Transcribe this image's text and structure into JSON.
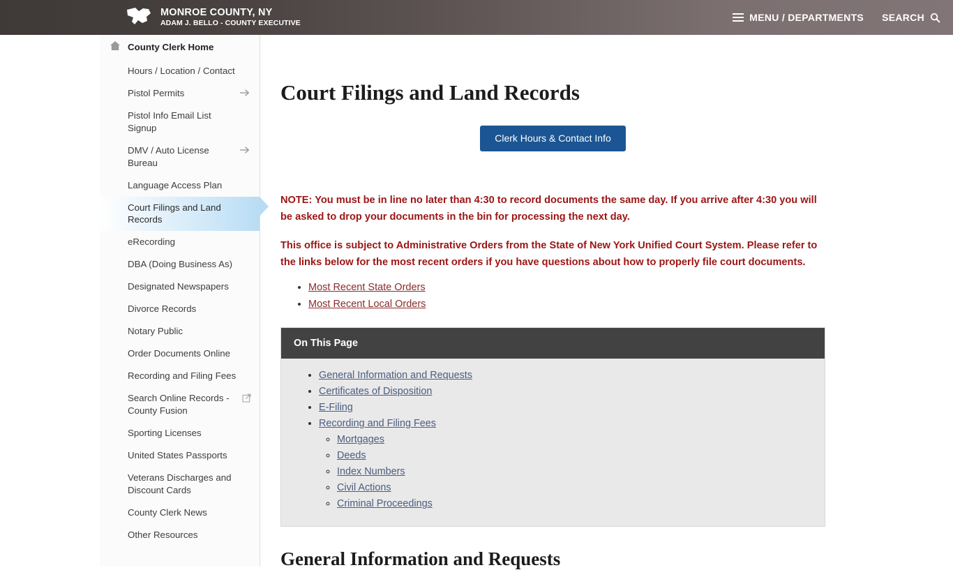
{
  "header": {
    "logo_icon": "monroe-county-map-logo",
    "brand_title": "MONROE COUNTY, NY",
    "brand_subtitle": "ADAM J. BELLO - COUNTY EXECUTIVE",
    "menu_label": "MENU / DEPARTMENTS",
    "menu_icon": "hamburger-icon",
    "search_label": "SEARCH",
    "search_icon": "search-icon",
    "gradient_left": "#3f3938",
    "gradient_right": "#827577"
  },
  "sidebar": {
    "home": {
      "label": "County Clerk Home",
      "icon": "home-icon"
    },
    "items": [
      {
        "label": "Hours / Location / Contact",
        "icon": "",
        "active": false
      },
      {
        "label": "Pistol Permits",
        "icon": "arrow-right-icon",
        "active": false
      },
      {
        "label": "Pistol Info Email List Signup",
        "icon": "",
        "active": false
      },
      {
        "label": "DMV / Auto License Bureau",
        "icon": "arrow-right-icon",
        "active": false
      },
      {
        "label": "Language Access Plan",
        "icon": "",
        "active": false
      },
      {
        "label": "Court Filings and Land Records",
        "icon": "",
        "active": true
      },
      {
        "label": "eRecording",
        "icon": "",
        "active": false
      },
      {
        "label": "DBA (Doing Business As)",
        "icon": "",
        "active": false
      },
      {
        "label": "Designated Newspapers",
        "icon": "",
        "active": false
      },
      {
        "label": "Divorce Records",
        "icon": "",
        "active": false
      },
      {
        "label": "Notary Public",
        "icon": "",
        "active": false
      },
      {
        "label": "Order Documents Online",
        "icon": "",
        "active": false
      },
      {
        "label": "Recording and Filing Fees",
        "icon": "",
        "active": false
      },
      {
        "label": "Search Online Records - County Fusion",
        "icon": "external-link-icon",
        "active": false
      },
      {
        "label": "Sporting Licenses",
        "icon": "",
        "active": false
      },
      {
        "label": "United States Passports",
        "icon": "",
        "active": false
      },
      {
        "label": "Veterans Discharges and Discount Cards",
        "icon": "",
        "active": false
      },
      {
        "label": "County Clerk News",
        "icon": "",
        "active": false
      },
      {
        "label": "Other Resources",
        "icon": "",
        "active": false
      }
    ],
    "active_color": "#b9dcf4"
  },
  "main": {
    "page_title": "Court Filings and Land Records",
    "contact_button": "Clerk Hours & Contact Info",
    "contact_button_color": "#1c5593",
    "note_color": "#9c1515",
    "note_1": "NOTE: You must be in line no later than 4:30 to record documents the same day.  If you arrive after 4:30 you will be asked to drop your documents in the bin for processing the next day.",
    "note_2": "This office is subject to Administrative Orders from the State of New York Unified Court System.  Please refer to the links below for the most recent orders if you have questions about how to properly file court documents.",
    "order_links": [
      "Most Recent State Orders",
      "Most Recent Local Orders"
    ],
    "on_this_page": {
      "title": "On This Page",
      "header_color": "#424242",
      "body_color": "#e9e9e9",
      "link_color": "#4a5d80",
      "items": [
        {
          "label": "General Information and Requests",
          "children": []
        },
        {
          "label": "Certificates of Disposition",
          "children": []
        },
        {
          "label": "E-Filing",
          "children": []
        },
        {
          "label": "Recording and Filing Fees",
          "children": [
            "Mortgages",
            "Deeds",
            "Index Numbers",
            "Civil Actions",
            "Criminal Proceedings"
          ]
        }
      ]
    },
    "section_heading": "General Information and Requests"
  }
}
